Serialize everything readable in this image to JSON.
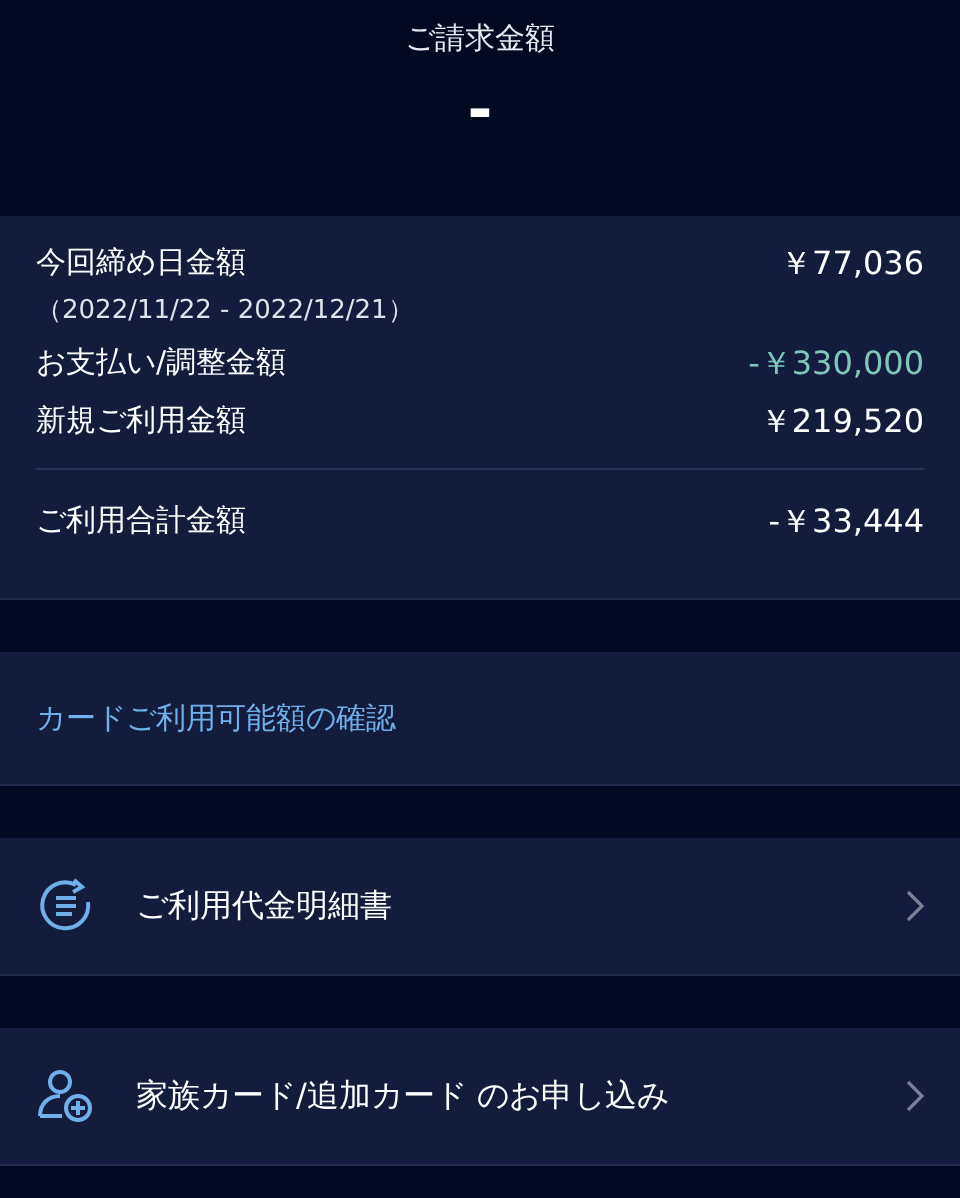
{
  "header": {
    "title": "ご請求金額",
    "amount": "-"
  },
  "summary": {
    "rows": [
      {
        "label": "今回締め日金額",
        "sub": "（2022/11/22 - 2022/12/21）",
        "value": "￥77,036",
        "color": "#ffffff"
      },
      {
        "label": "お支払い/調整金額",
        "value": "-￥330,000",
        "color": "#7fc8b8"
      },
      {
        "label": "新規ご利用金額",
        "value": "￥219,520",
        "color": "#ffffff"
      }
    ],
    "total": {
      "label": "ご利用合計金額",
      "value": "-￥33,444"
    }
  },
  "link": "カードご利用可能額の確認",
  "menu": [
    {
      "kind": "statement",
      "label": "ご利用代金明細書"
    },
    {
      "kind": "family",
      "label": "家族カード/追加カード のお申し込み"
    }
  ]
}
